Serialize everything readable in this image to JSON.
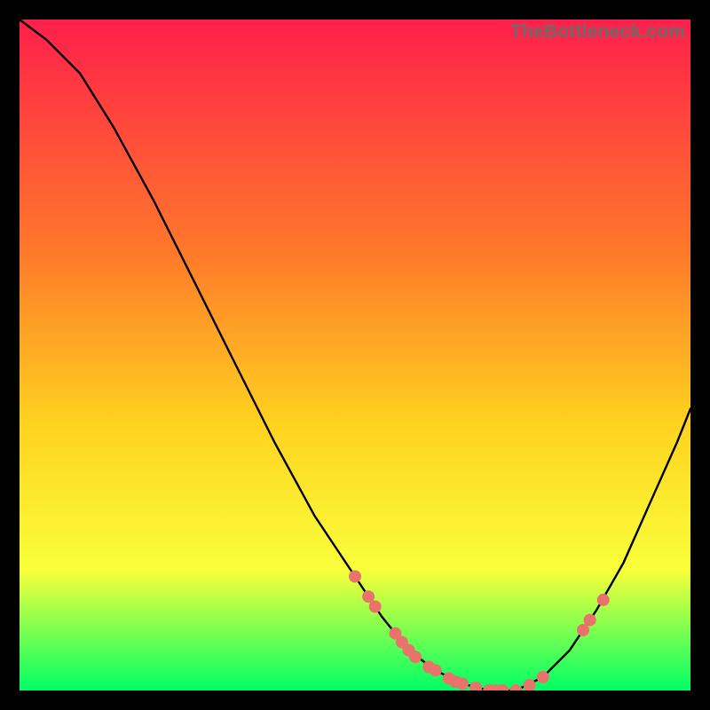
{
  "watermark": "TheBottleneck.com",
  "colors": {
    "gradient_top": "#ff1f4b",
    "gradient_mid1": "#ff7a2a",
    "gradient_mid2": "#ffd21f",
    "gradient_mid3": "#f9ff3a",
    "gradient_bottom": "#00ff66",
    "curve": "#000000",
    "dot": "#e9736b"
  },
  "chart_data": {
    "type": "line",
    "title": "",
    "xlabel": "",
    "ylabel": "",
    "xlim": [
      0,
      100
    ],
    "ylim": [
      0,
      100
    ],
    "curve": [
      {
        "x": 0,
        "y": 100
      },
      {
        "x": 4,
        "y": 97
      },
      {
        "x": 9,
        "y": 92
      },
      {
        "x": 14,
        "y": 84
      },
      {
        "x": 20,
        "y": 73
      },
      {
        "x": 26,
        "y": 61
      },
      {
        "x": 32,
        "y": 49
      },
      {
        "x": 38,
        "y": 37
      },
      {
        "x": 44,
        "y": 26
      },
      {
        "x": 50,
        "y": 17
      },
      {
        "x": 54,
        "y": 11
      },
      {
        "x": 58,
        "y": 6
      },
      {
        "x": 62,
        "y": 3
      },
      {
        "x": 66,
        "y": 1
      },
      {
        "x": 70,
        "y": 0
      },
      {
        "x": 74,
        "y": 0
      },
      {
        "x": 78,
        "y": 2
      },
      {
        "x": 82,
        "y": 6
      },
      {
        "x": 86,
        "y": 12
      },
      {
        "x": 90,
        "y": 19
      },
      {
        "x": 94,
        "y": 28
      },
      {
        "x": 98,
        "y": 37
      },
      {
        "x": 100,
        "y": 42
      }
    ],
    "dots": [
      {
        "x": 50,
        "y": 17
      },
      {
        "x": 52,
        "y": 14
      },
      {
        "x": 53,
        "y": 12.5
      },
      {
        "x": 56,
        "y": 8.5
      },
      {
        "x": 57,
        "y": 7.2
      },
      {
        "x": 58,
        "y": 6
      },
      {
        "x": 59,
        "y": 5
      },
      {
        "x": 61,
        "y": 3.5
      },
      {
        "x": 62,
        "y": 3
      },
      {
        "x": 64,
        "y": 1.8
      },
      {
        "x": 65,
        "y": 1.3
      },
      {
        "x": 66,
        "y": 1
      },
      {
        "x": 68,
        "y": 0.4
      },
      {
        "x": 70,
        "y": 0
      },
      {
        "x": 71,
        "y": 0
      },
      {
        "x": 72,
        "y": 0
      },
      {
        "x": 74,
        "y": 0
      },
      {
        "x": 76,
        "y": 0.8
      },
      {
        "x": 78,
        "y": 2
      },
      {
        "x": 84,
        "y": 9
      },
      {
        "x": 85,
        "y": 10.5
      },
      {
        "x": 87,
        "y": 13.5
      }
    ]
  }
}
